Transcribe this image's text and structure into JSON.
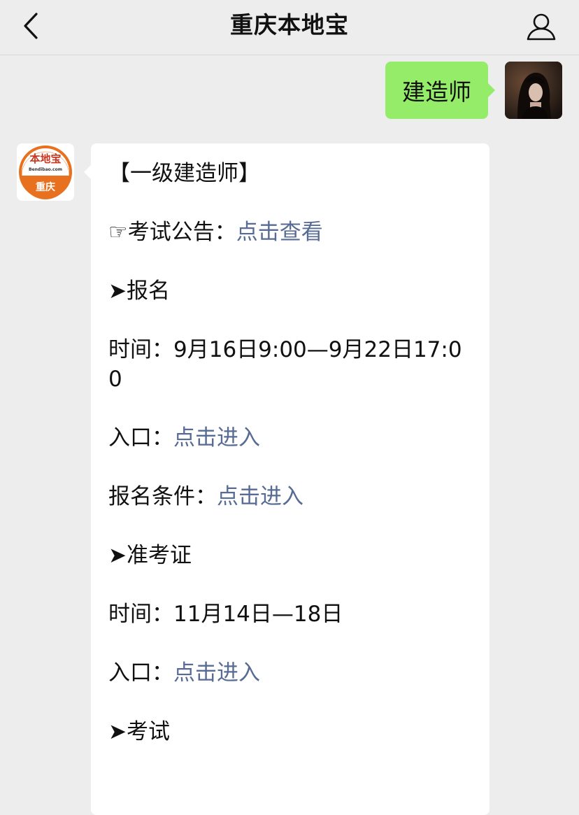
{
  "header": {
    "title": "重庆本地宝"
  },
  "outgoing": {
    "text": "建造师"
  },
  "bot_avatar": {
    "brand": "本地宝",
    "domain": "Bendibao.com",
    "city": "重庆"
  },
  "reply": {
    "heading": "【一级建造师】",
    "notice": {
      "label": "☞考试公告：",
      "link": "点击查看"
    },
    "sec_registration": "➤报名",
    "reg_time": {
      "label": "时间：",
      "value": "9月16日9:00—9月22日17:00"
    },
    "reg_entry": {
      "label": "入口：",
      "link": "点击进入"
    },
    "reg_conditions": {
      "label": "报名条件：",
      "link": "点击进入"
    },
    "sec_admission": "➤准考证",
    "adm_time": {
      "label": "时间：",
      "value": "11月14日—18日"
    },
    "adm_entry": {
      "label": "入口：",
      "link": "点击进入"
    },
    "sec_exam": "➤考试"
  },
  "colors": {
    "background": "#ededed",
    "outgoing_bubble": "#95ec69",
    "incoming_bubble": "#ffffff",
    "link": "#576b95",
    "brand_orange": "#e8711f"
  },
  "icons": {
    "back": "chevron-left-icon",
    "profile": "person-outline-icon"
  }
}
